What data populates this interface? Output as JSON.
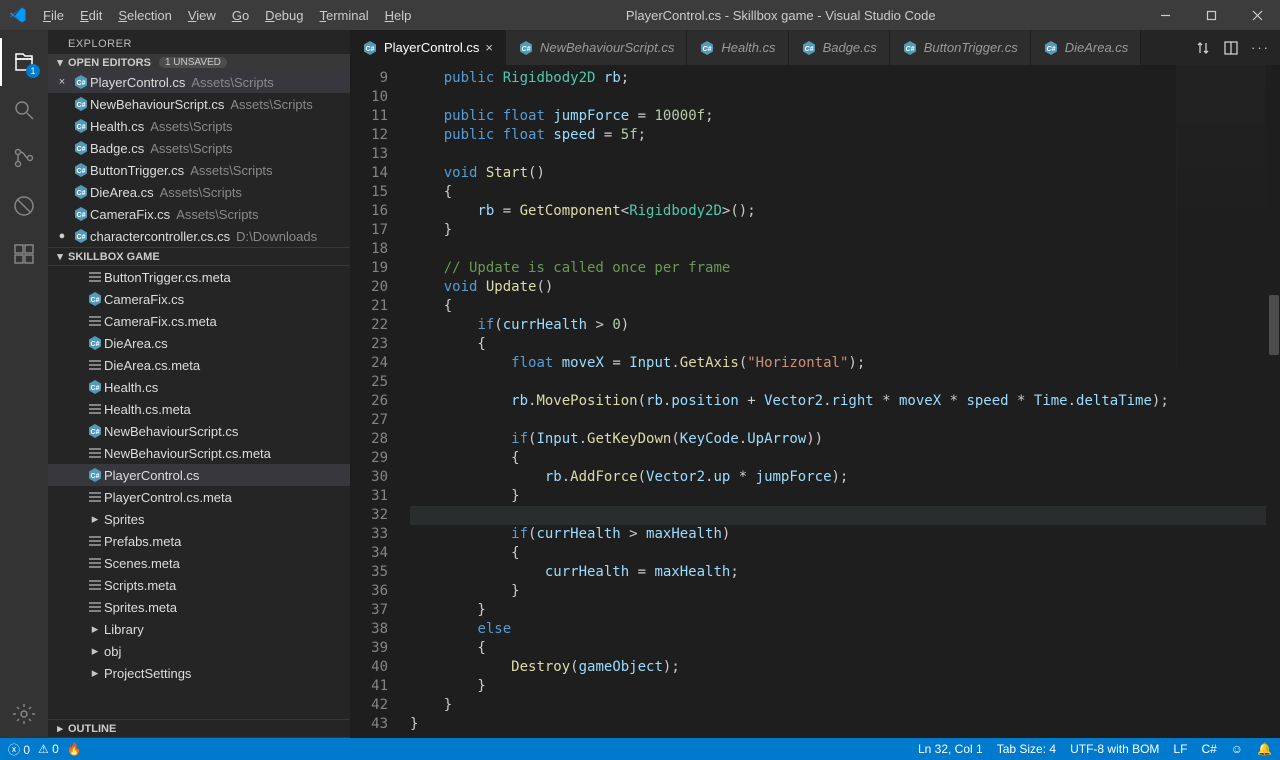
{
  "window": {
    "title": "PlayerControl.cs - Skillbox game - Visual Studio Code"
  },
  "menu": [
    "File",
    "Edit",
    "Selection",
    "View",
    "Go",
    "Debug",
    "Terminal",
    "Help"
  ],
  "activity": {
    "explorer_badge": "1"
  },
  "explorer": {
    "title": "EXPLORER",
    "openEditors": {
      "label": "OPEN EDITORS",
      "unsavedTag": "1 UNSAVED",
      "items": [
        {
          "pre": "×",
          "name": "PlayerControl.cs",
          "desc": "Assets\\Scripts",
          "sel": true,
          "mod": false
        },
        {
          "pre": "",
          "name": "NewBehaviourScript.cs",
          "desc": "Assets\\Scripts"
        },
        {
          "pre": "",
          "name": "Health.cs",
          "desc": "Assets\\Scripts"
        },
        {
          "pre": "",
          "name": "Badge.cs",
          "desc": "Assets\\Scripts"
        },
        {
          "pre": "",
          "name": "ButtonTrigger.cs",
          "desc": "Assets\\Scripts"
        },
        {
          "pre": "",
          "name": "DieArea.cs",
          "desc": "Assets\\Scripts"
        },
        {
          "pre": "",
          "name": "CameraFix.cs",
          "desc": "Assets\\Scripts"
        },
        {
          "pre": "●",
          "name": "charactercontroller.cs.cs",
          "desc": "D:\\Downloads"
        }
      ]
    },
    "workspace": {
      "label": "SKILLBOX GAME",
      "items": [
        {
          "type": "meta",
          "name": "ButtonTrigger.cs.meta"
        },
        {
          "type": "cs",
          "name": "CameraFix.cs"
        },
        {
          "type": "meta",
          "name": "CameraFix.cs.meta"
        },
        {
          "type": "cs",
          "name": "DieArea.cs"
        },
        {
          "type": "meta",
          "name": "DieArea.cs.meta"
        },
        {
          "type": "cs",
          "name": "Health.cs"
        },
        {
          "type": "meta",
          "name": "Health.cs.meta"
        },
        {
          "type": "cs",
          "name": "NewBehaviourScript.cs"
        },
        {
          "type": "meta",
          "name": "NewBehaviourScript.cs.meta"
        },
        {
          "type": "cs",
          "name": "PlayerControl.cs",
          "sel": true
        },
        {
          "type": "meta",
          "name": "PlayerControl.cs.meta"
        },
        {
          "type": "folder",
          "name": "Sprites"
        },
        {
          "type": "meta",
          "name": "Prefabs.meta"
        },
        {
          "type": "meta",
          "name": "Scenes.meta"
        },
        {
          "type": "meta",
          "name": "Scripts.meta"
        },
        {
          "type": "meta",
          "name": "Sprites.meta"
        },
        {
          "type": "folder",
          "name": "Library"
        },
        {
          "type": "folder",
          "name": "obj"
        },
        {
          "type": "folder",
          "name": "ProjectSettings"
        }
      ]
    },
    "outline": "OUTLINE"
  },
  "tabs": [
    {
      "name": "PlayerControl.cs",
      "active": true
    },
    {
      "name": "NewBehaviourScript.cs"
    },
    {
      "name": "Health.cs"
    },
    {
      "name": "Badge.cs"
    },
    {
      "name": "ButtonTrigger.cs"
    },
    {
      "name": "DieArea.cs"
    }
  ],
  "code": {
    "firstLine": 9,
    "currentLine": 32,
    "lines": [
      {
        "n": 9,
        "h": "    <span class='kw'>public</span> <span class='type'>Rigidbody2D</span> <span class='id'>rb</span>;"
      },
      {
        "n": 10,
        "h": ""
      },
      {
        "n": 11,
        "h": "    <span class='kw'>public</span> <span class='kw'>float</span> <span class='id'>jumpForce</span> = <span class='num'>10000f</span>;"
      },
      {
        "n": 12,
        "h": "    <span class='kw'>public</span> <span class='kw'>float</span> <span class='id'>speed</span> = <span class='num'>5f</span>;"
      },
      {
        "n": 13,
        "h": ""
      },
      {
        "n": 14,
        "h": "    <span class='kw'>void</span> <span class='fn'>Start</span>()"
      },
      {
        "n": 15,
        "h": "    {"
      },
      {
        "n": 16,
        "h": "        <span class='id'>rb</span> = <span class='fn'>GetComponent</span>&lt;<span class='type'>Rigidbody2D</span>&gt;();"
      },
      {
        "n": 17,
        "h": "    }"
      },
      {
        "n": 18,
        "h": ""
      },
      {
        "n": 19,
        "h": "    <span class='cmt'>// Update is called once per frame</span>"
      },
      {
        "n": 20,
        "h": "    <span class='kw'>void</span> <span class='fn'>Update</span>()"
      },
      {
        "n": 21,
        "h": "    {"
      },
      {
        "n": 22,
        "h": "        <span class='kw'>if</span>(<span class='id'>currHealth</span> &gt; <span class='num'>0</span>)"
      },
      {
        "n": 23,
        "h": "        {"
      },
      {
        "n": 24,
        "h": "            <span class='kw'>float</span> <span class='id'>moveX</span> = <span class='id'>Input</span>.<span class='fn'>GetAxis</span>(<span class='str'>\"Horizontal\"</span>);"
      },
      {
        "n": 25,
        "h": ""
      },
      {
        "n": 26,
        "h": "            <span class='id'>rb</span>.<span class='fn'>MovePosition</span>(<span class='id'>rb</span>.<span class='id'>position</span> + <span class='id'>Vector2</span>.<span class='id'>right</span> * <span class='id'>moveX</span> * <span class='id'>speed</span> * <span class='id'>Time</span>.<span class='id'>deltaTime</span>);"
      },
      {
        "n": 27,
        "h": ""
      },
      {
        "n": 28,
        "h": "            <span class='kw'>if</span>(<span class='id'>Input</span>.<span class='fn'>GetKeyDown</span>(<span class='id'>KeyCode</span>.<span class='id'>UpArrow</span>))"
      },
      {
        "n": 29,
        "h": "            {"
      },
      {
        "n": 30,
        "h": "                <span class='id'>rb</span>.<span class='fn'>AddForce</span>(<span class='id'>Vector2</span>.<span class='id'>up</span> * <span class='id'>jumpForce</span>);"
      },
      {
        "n": 31,
        "h": "            }"
      },
      {
        "n": 32,
        "h": ""
      },
      {
        "n": 33,
        "h": "            <span class='kw'>if</span>(<span class='id'>currHealth</span> &gt; <span class='id'>maxHealth</span>)"
      },
      {
        "n": 34,
        "h": "            {"
      },
      {
        "n": 35,
        "h": "                <span class='id'>currHealth</span> = <span class='id'>maxHealth</span>;"
      },
      {
        "n": 36,
        "h": "            }"
      },
      {
        "n": 37,
        "h": "        }"
      },
      {
        "n": 38,
        "h": "        <span class='kw'>else</span>"
      },
      {
        "n": 39,
        "h": "        {"
      },
      {
        "n": 40,
        "h": "            <span class='fn'>Destroy</span>(<span class='id'>gameObject</span>);"
      },
      {
        "n": 41,
        "h": "        }"
      },
      {
        "n": 42,
        "h": "    }"
      },
      {
        "n": 43,
        "h": "}"
      }
    ]
  },
  "status": {
    "errors": "0",
    "warnings": "0",
    "lncol": "Ln 32, Col 1",
    "tabsize": "Tab Size: 4",
    "encoding": "UTF-8 with BOM",
    "eol": "LF",
    "lang": "C#"
  }
}
